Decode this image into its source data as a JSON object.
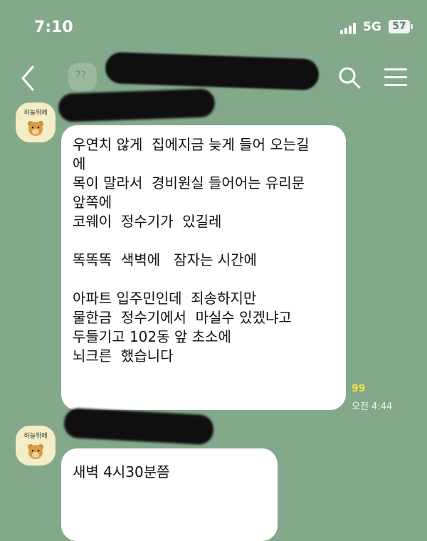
{
  "status_bar": {
    "time": "7:10",
    "network": "5G",
    "battery": "57"
  },
  "header": {
    "title": "",
    "subtitle": ""
  },
  "messages": [
    {
      "sender_label": "하늘위에",
      "text": "우연치 않게  집에지금 늦게 들어 오는길\n에\n목이 말라서  경비원실 들어어는 유리문\n앞쪽에\n코웨이  정수기가  있길레\n\n똑똑똑  색벽에   잠자는 시간에\n\n아파트 입주민인데  죄송하지만\n물한금  정수기에서  마실수 있겠냐고\n두들기고 102동 앞 초소에\n뇌크른  했습니다",
      "unread": "99",
      "time": "오전 4:44"
    },
    {
      "sender_label": "하늘위에",
      "text": "새벽 4시30분쯤"
    }
  ],
  "icons": {
    "back": "back-arrow-icon",
    "search": "search-icon",
    "menu": "hamburger-menu-icon",
    "signal": "signal-bars-icon",
    "battery": "battery-icon"
  },
  "colors": {
    "background": "#84a98a",
    "bubble": "#ffffff",
    "unread": "#f2e04e"
  }
}
